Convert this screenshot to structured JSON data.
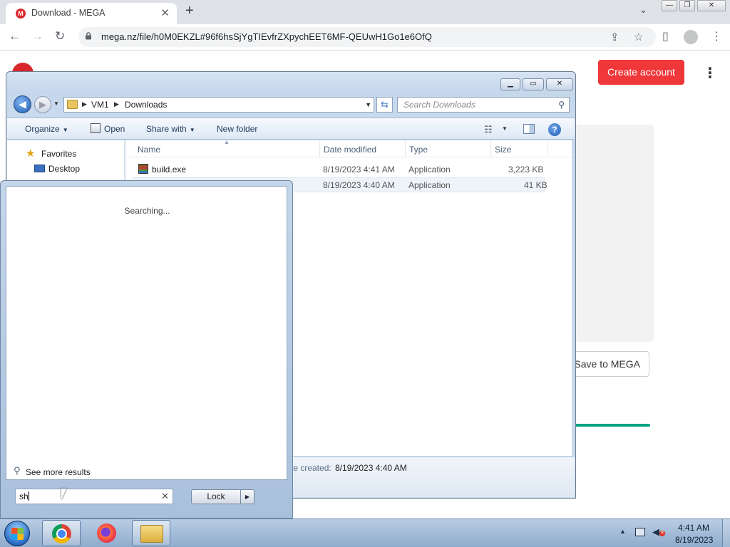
{
  "browser": {
    "tab_title": "Download - MEGA",
    "tab_favicon": "M",
    "close_glyph": "✕",
    "new_tab_glyph": "+",
    "tab_search_glyph": "⌄",
    "window_min": "—",
    "window_restore": "❐",
    "window_close": "✕",
    "back_glyph": "←",
    "forward_glyph": "→",
    "reload_glyph": "↻",
    "url": "mega.nz/file/h0M0EKZL#96f6hsSjYgTIEvfrZXpychEET6MF-QEUwH1Go1e6OfQ",
    "share_glyph": "⇪",
    "bookmark_glyph": "☆",
    "sidepanel_glyph": "▯",
    "menu_glyph": "⋮"
  },
  "mega": {
    "create_account": "Create account",
    "save_to_mega": "Save to MEGA",
    "menu_glyph": "⋮",
    "accent_color": "#f0373a"
  },
  "explorer": {
    "window_min": "▁",
    "window_max": "▭",
    "window_close": "✕",
    "back_glyph": "◀",
    "forward_glyph": "▶",
    "path": [
      "VM1",
      "Downloads"
    ],
    "search_placeholder": "Search Downloads",
    "commands": {
      "organize": "Organize",
      "open": "Open",
      "share_with": "Share with",
      "new_folder": "New folder"
    },
    "nav": {
      "favorites": "Favorites",
      "desktop": "Desktop"
    },
    "columns": [
      "Name",
      "Date modified",
      "Type",
      "Size"
    ],
    "files": [
      {
        "name": "build.exe",
        "date": "8/19/2023 4:41 AM",
        "type": "Application",
        "size": "3,223 KB"
      },
      {
        "name": "",
        "date": "8/19/2023 4:40 AM",
        "type": "Application",
        "size": "41 KB"
      }
    ],
    "details": {
      "created_label": "te created:",
      "created_value": "8/19/2023 4:40 AM"
    }
  },
  "start_menu": {
    "status": "Searching...",
    "see_more": "See more results",
    "search_value": "sh",
    "clear_glyph": "✕",
    "lock_label": "Lock",
    "lock_arrow": "▶"
  },
  "taskbar": {
    "time": "4:41 AM",
    "date": "8/19/2023",
    "tray_chevron": "▲"
  }
}
